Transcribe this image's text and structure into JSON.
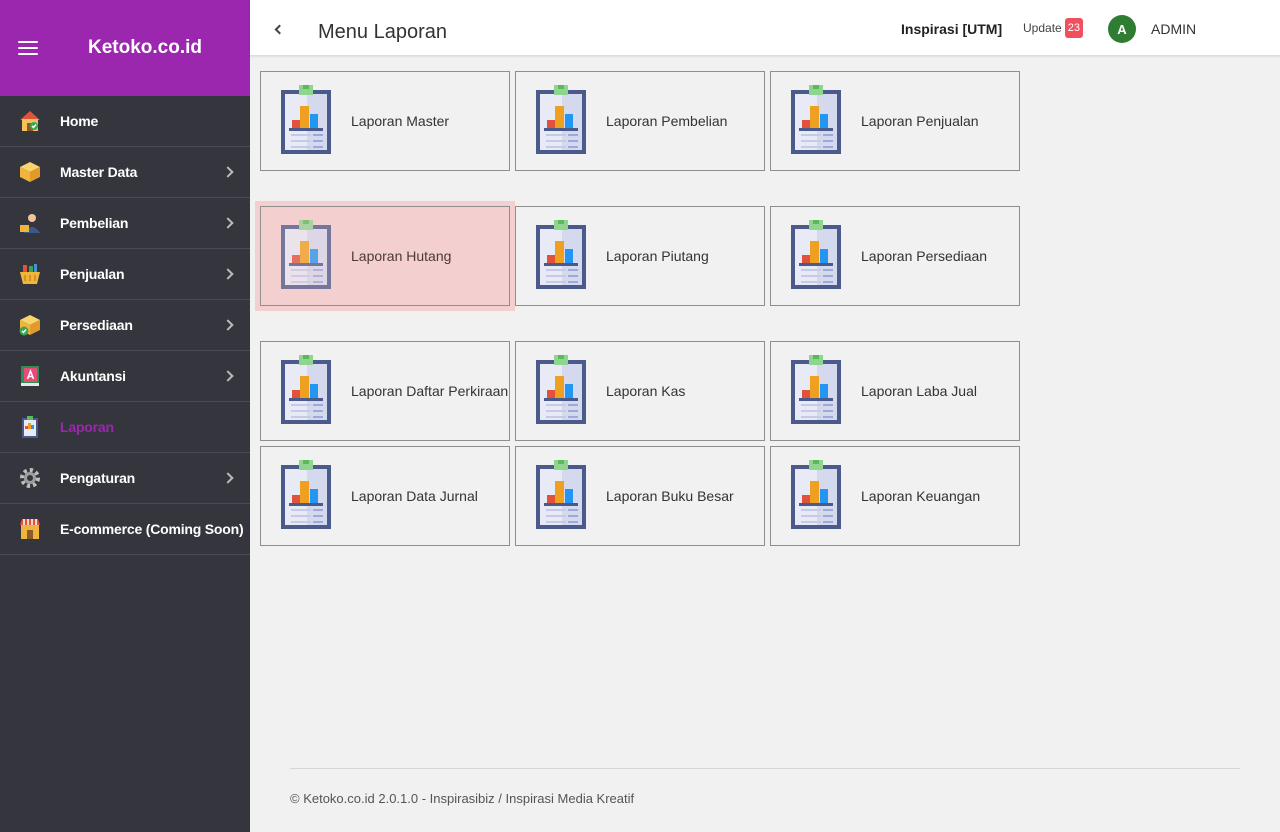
{
  "sidebar": {
    "brand": "Ketoko.co.id",
    "items": [
      {
        "label": "Home",
        "icon": "home-icon"
      },
      {
        "label": "Master Data",
        "icon": "box-icon"
      },
      {
        "label": "Pembelian",
        "icon": "user-box-icon"
      },
      {
        "label": "Penjualan",
        "icon": "basket-icon"
      },
      {
        "label": "Persediaan",
        "icon": "box-check-icon"
      },
      {
        "label": "Akuntansi",
        "icon": "book-icon"
      },
      {
        "label": "Laporan",
        "icon": "clipboard-chart-icon"
      },
      {
        "label": "Pengaturan",
        "icon": "gear-icon"
      },
      {
        "label": "E-commerce (Coming Soon)",
        "icon": "shop-icon"
      }
    ],
    "active_item": "Laporan"
  },
  "header": {
    "title": "Menu Laporan",
    "company": "Inspirasi [UTM]",
    "update_label": "Update",
    "update_count": "23",
    "avatar_letter": "A",
    "username": "ADMIN"
  },
  "reports": [
    "Laporan Master",
    "Laporan Pembelian",
    "Laporan Penjualan",
    "Laporan Hutang",
    "Laporan Piutang",
    "Laporan Persediaan",
    "Laporan Daftar Perkiraan",
    "Laporan Kas",
    "Laporan Laba Jual",
    "Laporan Data Jurnal",
    "Laporan Buku Besar",
    "Laporan Keuangan"
  ],
  "hovered_report": "Laporan Hutang",
  "footer": "© Ketoko.co.id 2.0.1.0 - Inspirasibiz / Inspirasi Media Kreatif",
  "colors": {
    "brand": "#9b27af",
    "sidebar": "#35363d",
    "badge": "#f0505d",
    "avatar": "#2e7d32",
    "hover": "#f3cfcf"
  }
}
